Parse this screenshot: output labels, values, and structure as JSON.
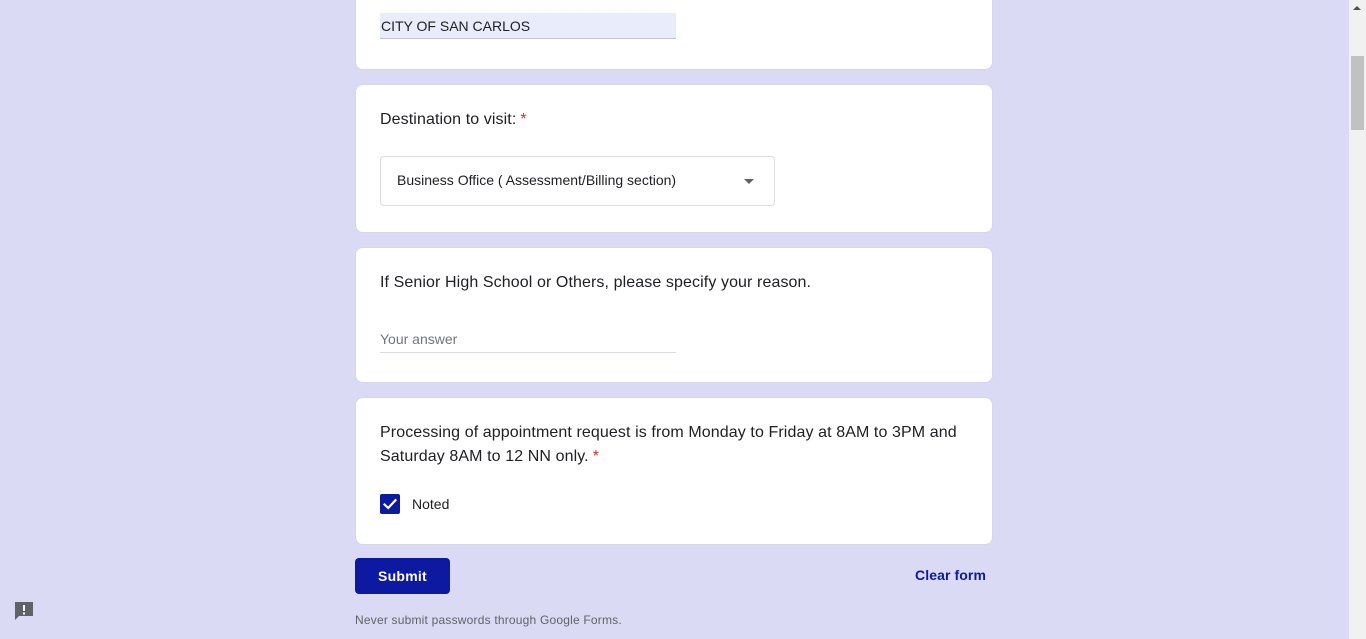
{
  "city_answer": "CITY OF SAN CARLOS",
  "destination": {
    "question": "Destination to visit:",
    "required_mark": "*",
    "selected_value": "Business Office ( Assessment/Billing section)"
  },
  "reason": {
    "question": "If Senior High School or Others, please specify your reason.",
    "placeholder": "Your answer"
  },
  "processing": {
    "question_line1": "Processing of appointment request is from Monday to Friday at 8AM to 3PM and",
    "question_line2": "Saturday 8AM to 12 NN only.",
    "required_mark": "*",
    "checkbox_label": "Noted",
    "checked": true
  },
  "actions": {
    "submit_label": "Submit",
    "clear_label": "Clear form"
  },
  "footer": {
    "disclaimer": "Never submit passwords through Google Forms."
  },
  "icons": {
    "dropdown": "chevron-down-icon",
    "check": "check-icon",
    "feedback": "report-issue-icon"
  },
  "colors": {
    "background": "#dadaf4",
    "accent": "#0b1aa0",
    "required": "#d93025"
  }
}
